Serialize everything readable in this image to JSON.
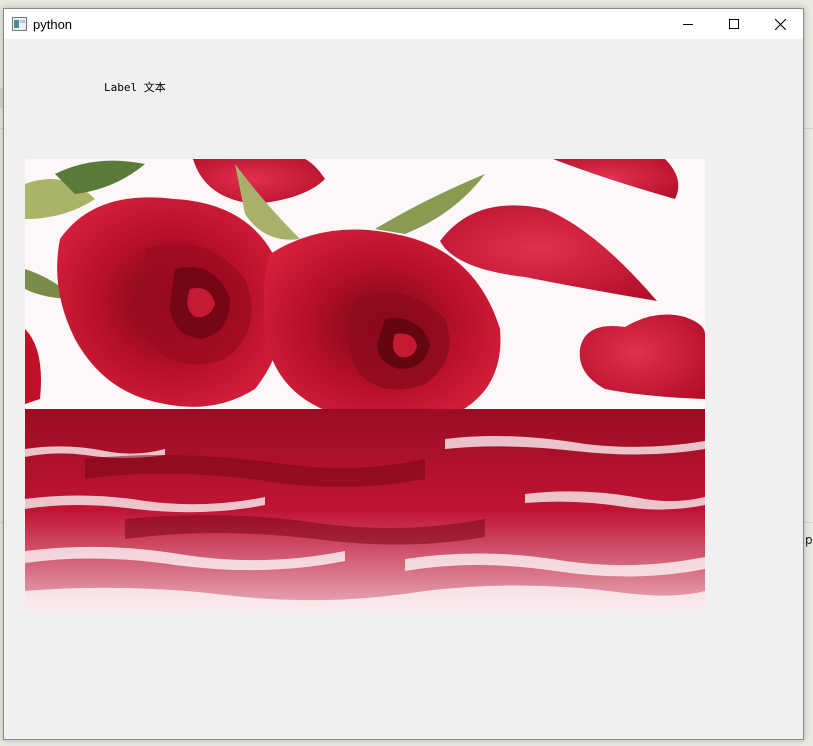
{
  "window": {
    "title": "python",
    "app_icon": "python-window-icon",
    "controls": {
      "minimize_icon": "minimize-icon",
      "maximize_icon": "maximize-icon",
      "close_icon": "close-icon"
    }
  },
  "content": {
    "label_text": "Label 文本",
    "image": {
      "subject": "red roses and petals reflected in water",
      "colors": {
        "rose": "#c0102a",
        "rose_dark": "#8a0a1c",
        "petal": "#d31a3a",
        "leaf": "#9aa65a",
        "background": "#ffffff"
      }
    }
  },
  "desktop": {
    "partial_text": "py"
  }
}
